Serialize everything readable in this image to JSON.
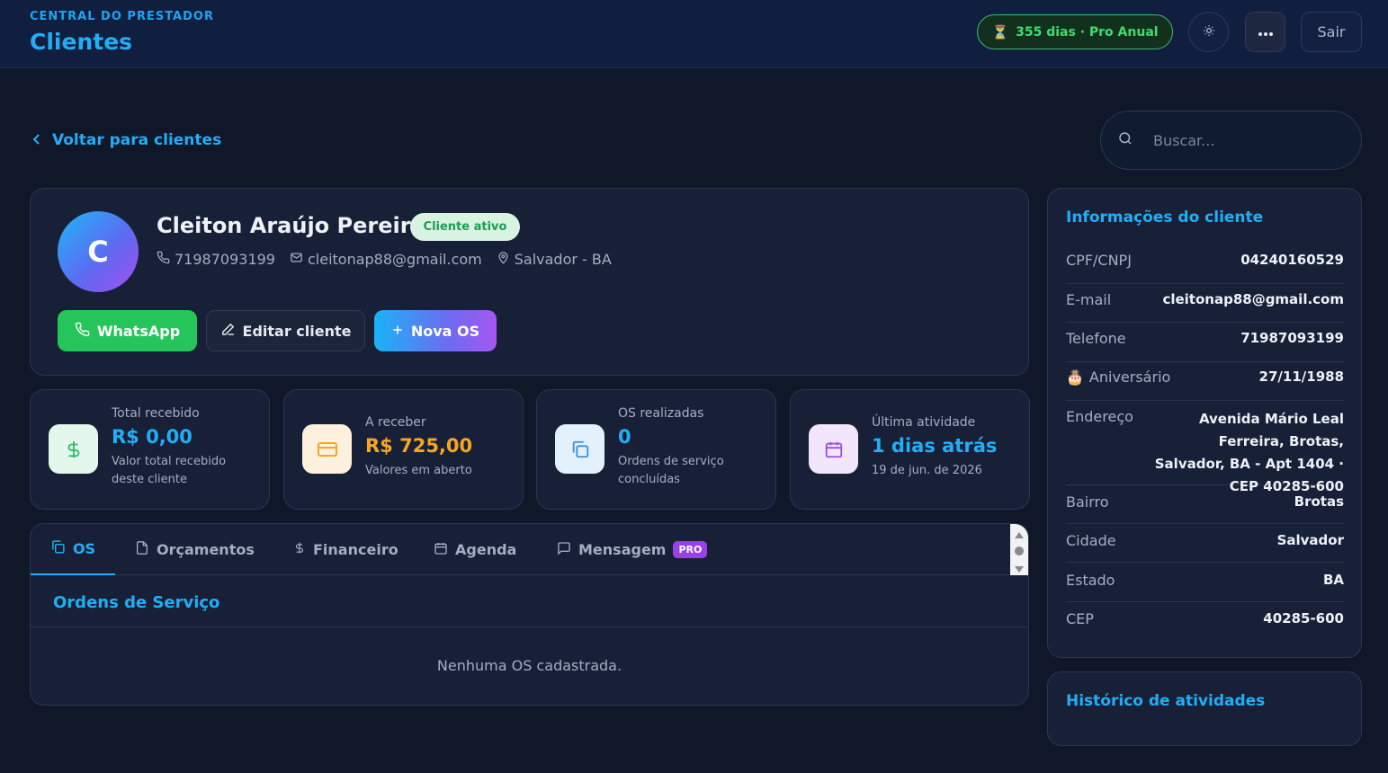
{
  "header": {
    "kicker": "CENTRAL DO PRESTADOR",
    "title": "Clientes",
    "plan_badge": "355 dias · Pro Anual",
    "logout_label": "Sair"
  },
  "nav": {
    "back_label": "Voltar para clientes",
    "search_placeholder": "Buscar..."
  },
  "client": {
    "initial": "C",
    "name": "Cleiton Araújo Pereira",
    "status": "Cliente ativo",
    "phone": "71987093199",
    "email": "cleitonap88@gmail.com",
    "location": "Salvador - BA"
  },
  "actions": {
    "whatsapp": "WhatsApp",
    "edit": "Editar cliente",
    "new_os": "Nova OS"
  },
  "stats": [
    {
      "label": "Total recebido",
      "value": "R$ 0,00",
      "sub": "Valor total recebido deste cliente",
      "color": "#22aef7",
      "icon": "dollar-icon"
    },
    {
      "label": "A receber",
      "value": "R$ 725,00",
      "sub": "Valores em aberto",
      "color": "#f5a623",
      "icon": "credit-card-icon"
    },
    {
      "label": "OS realizadas",
      "value": "0",
      "sub": "Ordens de serviço concluídas",
      "color": "#22aef7",
      "icon": "copy-icon"
    },
    {
      "label": "Última atividade",
      "value": "1 dias atrás",
      "sub": "19 de jun. de 2026",
      "color": "#22aef7",
      "icon": "calendar-icon"
    }
  ],
  "tabs": [
    {
      "label": "OS",
      "icon": "copy-icon"
    },
    {
      "label": "Orçamentos",
      "icon": "file-icon"
    },
    {
      "label": "Financeiro",
      "icon": "dollar-icon"
    },
    {
      "label": "Agenda",
      "icon": "calendar-icon"
    },
    {
      "label": "Mensagem",
      "icon": "message-icon",
      "badge": "PRO"
    }
  ],
  "os_section": {
    "title": "Ordens de Serviço",
    "empty": "Nenhuma OS cadastrada."
  },
  "info": {
    "title": "Informações do cliente",
    "rows": [
      {
        "k": "CPF/CNPJ",
        "v": "04240160529"
      },
      {
        "k": "E-mail",
        "v": "cleitonap88@gmail.com"
      },
      {
        "k": "Telefone",
        "v": "71987093199"
      },
      {
        "k": "Aniversário",
        "v": "27/11/1988"
      },
      {
        "k": "Endereço",
        "v": "Avenida Mário Leal Ferreira, Brotas, Salvador, BA - Apt 1404 · CEP 40285-600"
      },
      {
        "k": "Bairro",
        "v": "Brotas"
      },
      {
        "k": "Cidade",
        "v": "Salvador"
      },
      {
        "k": "Estado",
        "v": "BA"
      },
      {
        "k": "CEP",
        "v": "40285-600"
      }
    ]
  },
  "history": {
    "title": "Histórico de atividades"
  },
  "colors": {
    "accent": "#22aef7",
    "success": "#25c55b",
    "warning": "#f5a623",
    "background": "#0f1729",
    "card": "#172036"
  }
}
